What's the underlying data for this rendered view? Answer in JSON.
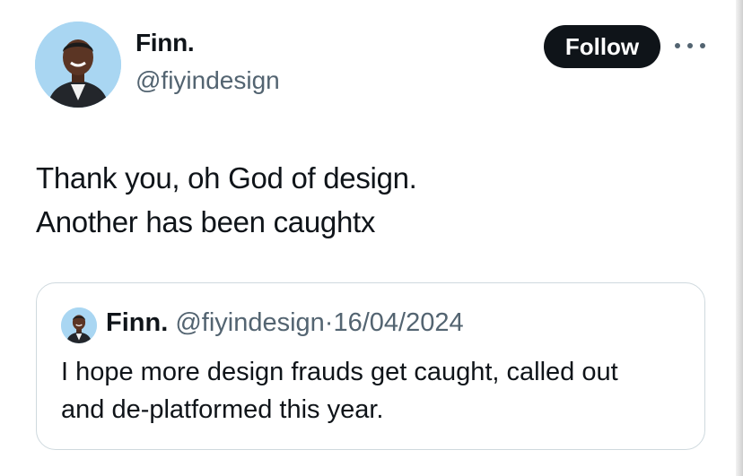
{
  "author": {
    "name": "Finn.",
    "handle": "@fiyindesign",
    "follow_label": "Follow"
  },
  "tweet": {
    "lines": [
      "Thank you, oh God of design.",
      "Another has been caughtx"
    ]
  },
  "quote": {
    "name": "Finn.",
    "handle": "@fiyindesign",
    "separator": "·",
    "date": "16/04/2024",
    "lines": [
      "I hope more design frauds get caught, called out",
      "and de-platformed this year."
    ]
  },
  "icons": {
    "more": "more-horizontal-icon",
    "avatar": "user-avatar"
  },
  "colors": {
    "text_primary": "#0f1419",
    "text_secondary": "#536471",
    "button_bg": "#0f1419",
    "button_text": "#ffffff",
    "border": "#cfd9de",
    "avatar_bg": "#a9d6f2"
  }
}
